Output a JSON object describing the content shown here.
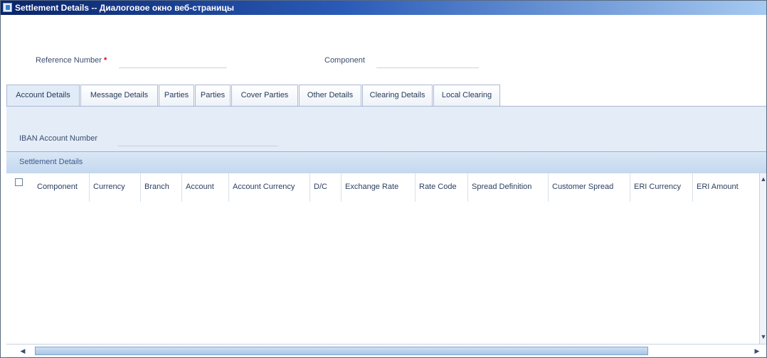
{
  "window": {
    "title": "Settlement Details -- Диалоговое окно веб-страницы",
    "icon": "window-app-icon"
  },
  "form": {
    "reference_number_label": "Reference Number",
    "required_marker": "*",
    "reference_number_value": "",
    "component_label": "Component",
    "component_value": "",
    "iban_label": "IBAN Account Number",
    "iban_value": ""
  },
  "tabs": [
    {
      "label": "Account Details",
      "active": true
    },
    {
      "label": "Message Details",
      "active": false
    },
    {
      "label": "Parties",
      "active": false
    },
    {
      "label": "Parties",
      "active": false
    },
    {
      "label": "Cover Parties",
      "active": false
    },
    {
      "label": "Other Details",
      "active": false
    },
    {
      "label": "Clearing Details",
      "active": false
    },
    {
      "label": "Local Clearing",
      "active": false
    }
  ],
  "grid": {
    "section_title": "Settlement Details",
    "select_all_checked": false,
    "columns": [
      "Component",
      "Currency",
      "Branch",
      "Account",
      "Account Currency",
      "D/C",
      "Exchange Rate",
      "Rate Code",
      "Spread Definition",
      "Customer Spread",
      "ERI Currency",
      "ERI Amount"
    ],
    "rows": []
  },
  "scrollbars": {
    "up_icon": "scroll-up-icon",
    "down_icon": "scroll-down-icon",
    "left_icon": "scroll-left-icon",
    "right_icon": "scroll-right-icon"
  }
}
